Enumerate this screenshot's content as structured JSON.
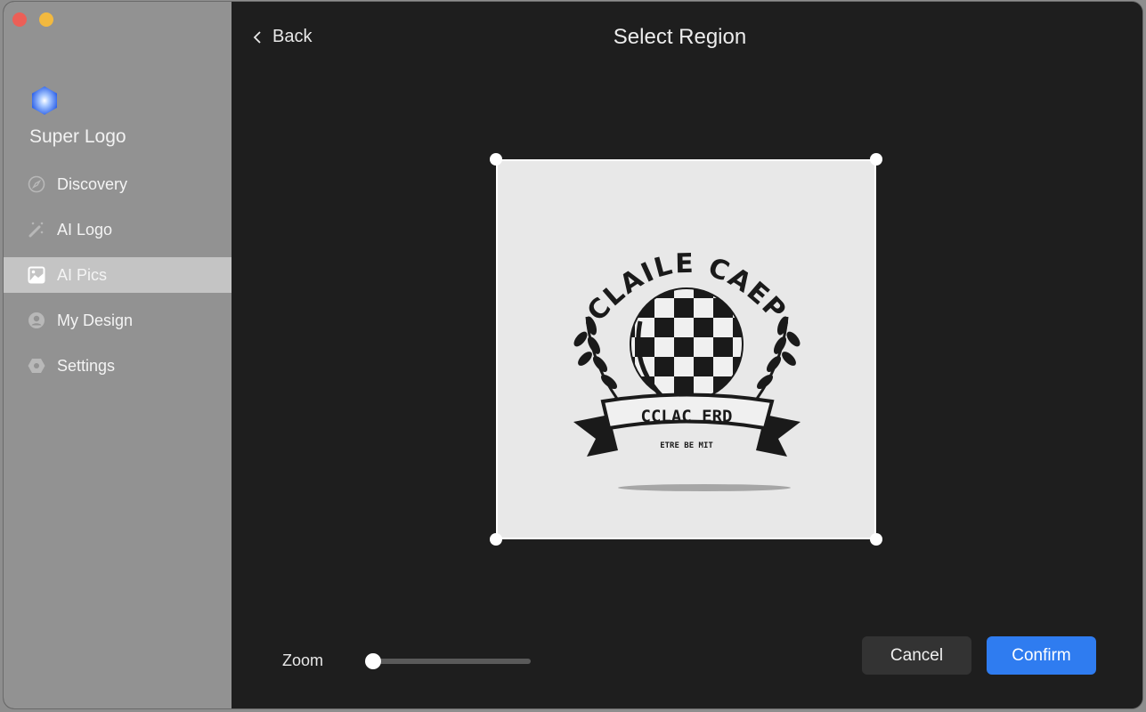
{
  "window": {
    "controls": [
      "close",
      "minimize"
    ]
  },
  "sidebar": {
    "app_name": "Super Logo",
    "app_icon": "hexagon-orb-icon",
    "items": [
      {
        "label": "Discovery",
        "icon": "compass-icon",
        "active": false
      },
      {
        "label": "AI Logo",
        "icon": "magic-wand-icon",
        "active": false
      },
      {
        "label": "AI Pics",
        "icon": "image-icon",
        "active": true
      },
      {
        "label": "My Design",
        "icon": "person-circle-icon",
        "active": false
      },
      {
        "label": "Settings",
        "icon": "gear-hexagon-icon",
        "active": false
      }
    ]
  },
  "header": {
    "back_label": "Back",
    "title": "Select Region"
  },
  "crop": {
    "image_text_top": "CLAILE CAEP",
    "image_text_banner": "CCLAC ERD",
    "image_text_small": "ETRE   BE MIT"
  },
  "zoom": {
    "label": "Zoom",
    "value_fraction": 0.0
  },
  "actions": {
    "cancel_label": "Cancel",
    "confirm_label": "Confirm"
  },
  "colors": {
    "accent": "#2f7cf0",
    "sidebar_bg": "#929292",
    "main_bg": "#1e1e1e",
    "active_item_bg": "#c4c4c4"
  }
}
